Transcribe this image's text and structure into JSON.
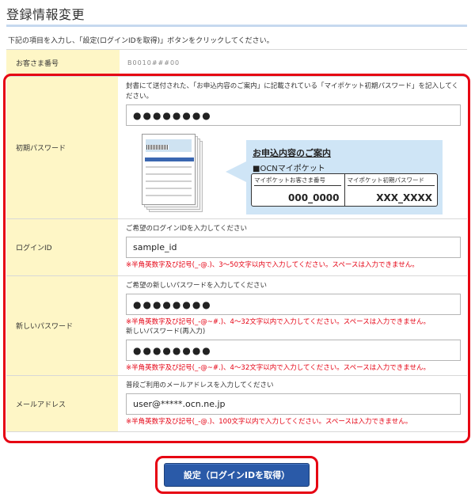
{
  "page": {
    "title": "登録情報変更",
    "instruction": "下記の項目を入力し、「設定(ログインIDを取得)」ボタンをクリックしてください。"
  },
  "colors": {
    "label_bg": "#fef6c6",
    "highlight_red": "#e60012",
    "warning_red": "#e50012",
    "button_blue": "#2a5aa8",
    "title_rule": "#c6d9ef"
  },
  "form": {
    "customer_number": {
      "label": "お客さま番号",
      "value": "B0010###00"
    },
    "initial_password": {
      "label": "初期パスワード",
      "description": "封書にて送付された、「お申込内容のご案内」に記載されている「マイポケット初期パスワード」を記入してください。",
      "value": "●●●●●●●●",
      "illustration": {
        "callout_title": "お申込内容のご案内",
        "callout_subtitle": "■OCNマイポケット",
        "customer_number_label": "マイポケットお客さま番号",
        "customer_number_value": "000_0000",
        "initial_password_label": "マイポケット初期パスワード",
        "initial_password_value": "XXX_XXXX"
      }
    },
    "login_id": {
      "label": "ログインID",
      "description": "ご希望のログインIDを入力してください",
      "value": "sample_id",
      "warning": "※半角英数字及び記号(_-@.)、3～50文字以内で入力してください。スペースは入力できません。"
    },
    "new_password": {
      "label": "新しいパスワード",
      "description": "ご希望の新しいパスワードを入力してください",
      "value": "●●●●●●●●",
      "warning": "※半角英数字及び記号(_-@~#.)、4～32文字以内で入力してください。スペースは入力できません。",
      "confirm_label": "新しいパスワード(再入力)",
      "confirm_value": "●●●●●●●●",
      "confirm_warning": "※半角英数字及び記号(_-@~#.)、4～32文字以内で入力してください。スペースは入力できません。"
    },
    "email": {
      "label": "メールアドレス",
      "description": "普段ご利用のメールアドレスを入力してください",
      "value": "user@*****.ocn.ne.jp",
      "warning": "※半角英数字及び記号(_-@.)、100文字以内で入力してください。スペースは入力できません。"
    }
  },
  "submit": {
    "label": "設定（ログインIDを取得）"
  }
}
